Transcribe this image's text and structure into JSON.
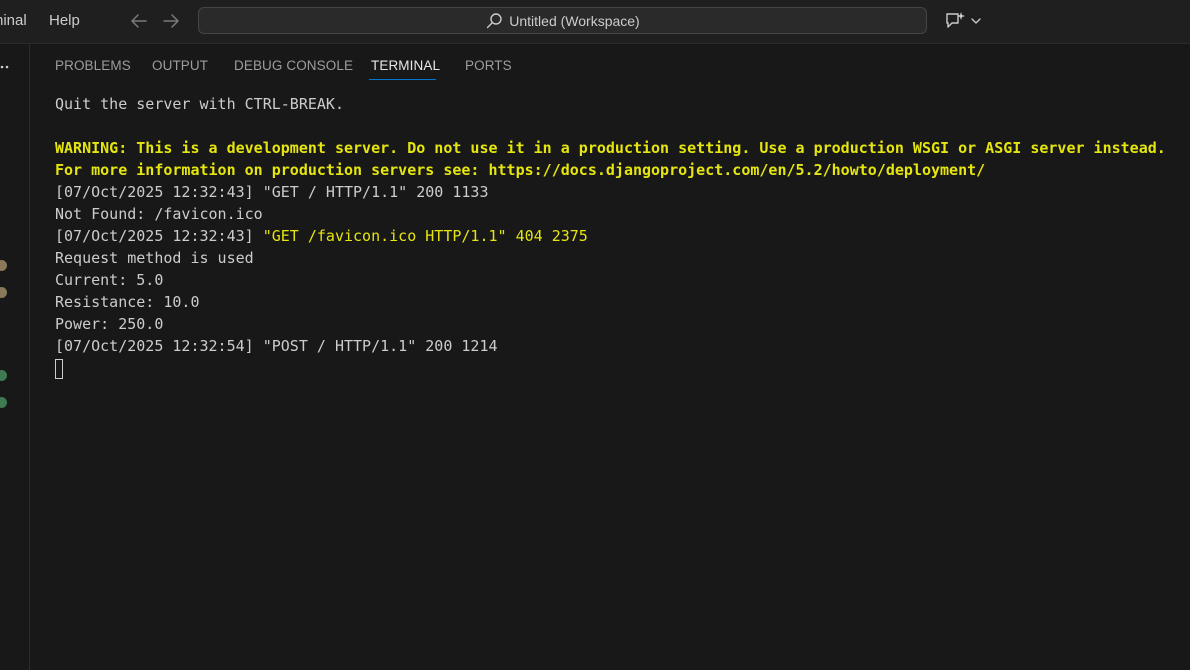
{
  "menu": {
    "terminal_label": "Terminal",
    "help_label": "Help"
  },
  "search": {
    "label": "Untitled (Workspace)"
  },
  "panel": {
    "tabs": [
      {
        "label": "PROBLEMS"
      },
      {
        "label": "OUTPUT"
      },
      {
        "label": "DEBUG CONSOLE"
      },
      {
        "label": "TERMINAL"
      },
      {
        "label": "PORTS"
      }
    ],
    "active_tab": "TERMINAL"
  },
  "terminal": {
    "lines": [
      {
        "text": "Quit the server with CTRL-BREAK."
      },
      {
        "text": ""
      },
      {
        "text": "WARNING: This is a development server. Do not use it in a production setting. Use a production WSGI or ASGI server instead."
      },
      {
        "text": "For more information on production servers see: https://docs.djangoproject.com/en/5.2/howto/deployment/"
      },
      {
        "text": "[07/Oct/2025 12:32:43] \"GET / HTTP/1.1\" 200 1133"
      },
      {
        "text": "Not Found: /favicon.ico"
      },
      {
        "prefix": "[07/Oct/2025 12:32:43] ",
        "highlight": "\"GET /favicon.ico HTTP/1.1\" 404 2375"
      },
      {
        "text": "Request method is used"
      },
      {
        "text": "Current: 5.0"
      },
      {
        "text": "Resistance: 10.0"
      },
      {
        "text": "Power: 250.0"
      },
      {
        "text": "[07/Oct/2025 12:32:54] \"POST / HTTP/1.1\" 200 1214"
      }
    ]
  },
  "colors": {
    "background": "#181818",
    "titlebar": "#1f1f1f",
    "warning_yellow": "#e5e510",
    "accent_blue": "#0078d4",
    "text": "#cccccc"
  },
  "icons": {
    "back": "arrow-left-icon",
    "forward": "arrow-right-icon",
    "search": "search-icon",
    "copilot": "copilot-icon",
    "chevron": "chevron-down-icon",
    "more": "more-icon"
  }
}
